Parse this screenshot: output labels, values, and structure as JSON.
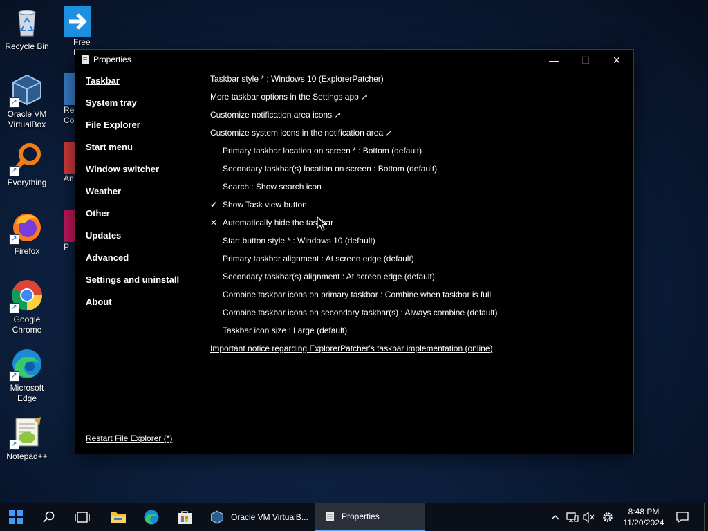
{
  "desktop": {
    "icons": [
      {
        "label": "Recycle Bin"
      },
      {
        "label": "Oracle VM VirtualBox"
      },
      {
        "label": "Everything"
      },
      {
        "label": "Firefox"
      },
      {
        "label": "Google Chrome"
      },
      {
        "label": "Microsoft Edge"
      },
      {
        "label": "Notepad++"
      }
    ],
    "partial_icons": [
      {
        "label": "Free Dow"
      },
      {
        "label": "Re Co"
      },
      {
        "label": "An"
      },
      {
        "label": "P"
      }
    ]
  },
  "window": {
    "title": "Properties",
    "controls": {
      "minimize": "—",
      "maximize": "☐",
      "close": "✕"
    },
    "nav": [
      {
        "label": "Taskbar",
        "active": true
      },
      {
        "label": "System tray"
      },
      {
        "label": "File Explorer"
      },
      {
        "label": "Start menu"
      },
      {
        "label": "Window switcher"
      },
      {
        "label": "Weather"
      },
      {
        "label": "Other"
      },
      {
        "label": "Updates"
      },
      {
        "label": "Advanced"
      },
      {
        "label": "Settings and uninstall"
      },
      {
        "label": "About"
      }
    ],
    "restart_link": "Restart File Explorer (*)",
    "options": [
      {
        "label": "Taskbar style * : Windows 10 (ExplorerPatcher)"
      },
      {
        "label": "More taskbar options in the Settings app ↗"
      },
      {
        "label": "Customize notification area icons ↗"
      },
      {
        "label": "Customize system icons in the notification area ↗"
      },
      {
        "label": "Primary taskbar location on screen * : Bottom (default)"
      },
      {
        "label": "Secondary taskbar(s) location on screen : Bottom (default)"
      },
      {
        "label": "Search : Show search icon"
      },
      {
        "label": "Show Task view button",
        "mark": "✔"
      },
      {
        "label": "Automatically hide the taskbar",
        "mark": "✕"
      },
      {
        "label": "Start button style * : Windows 10 (default)"
      },
      {
        "label": "Primary taskbar alignment : At screen edge (default)"
      },
      {
        "label": "Secondary taskbar(s) alignment : At screen edge (default)"
      },
      {
        "label": "Combine taskbar icons on primary taskbar : Combine when taskbar is full"
      },
      {
        "label": "Combine taskbar icons on secondary taskbar(s) : Always combine (default)"
      },
      {
        "label": "Taskbar icon size : Large (default)"
      },
      {
        "label": "Important notice regarding ExplorerPatcher's taskbar implementation (online)"
      }
    ]
  },
  "taskbar": {
    "apps": [
      {
        "label": "Oracle VM VirtualB..."
      },
      {
        "label": "Properties",
        "active": true
      }
    ],
    "tray": {
      "chevron": "^"
    },
    "clock": {
      "time": "8:48 PM",
      "date": "11/20/2024"
    }
  },
  "colors": {
    "accent": "#6aa5ff",
    "window_bg": "#000000",
    "taskbar_bg": "#0b0f18"
  }
}
